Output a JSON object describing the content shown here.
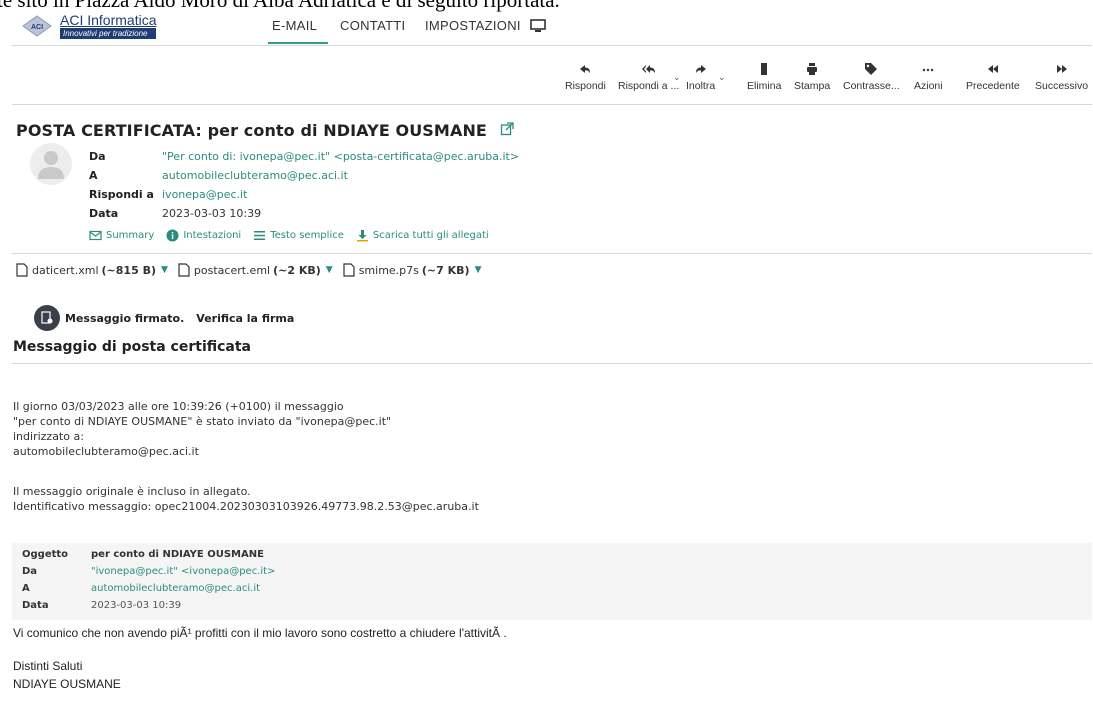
{
  "overlay_text": "te sito in Piazza Aldo Moro di Alba Adriatica e di seguito riportata.",
  "logo": {
    "title": "ACI Informatica",
    "subtitle": "Innovativi per tradizione",
    "mark": "ACI"
  },
  "nav": {
    "tabs": [
      "E-MAIL",
      "CONTATTI",
      "IMPOSTAZIONI"
    ],
    "active": "E-MAIL"
  },
  "toolbar": {
    "reply": "Rispondi",
    "reply_all": "Rispondi a ...",
    "forward": "Inoltra",
    "delete": "Elimina",
    "print": "Stampa",
    "tag": "Contrasse...",
    "actions": "Azioni",
    "previous": "Precedente",
    "next": "Successivo"
  },
  "message": {
    "subject": "POSTA CERTIFICATA: per conto di NDIAYE OUSMANE",
    "from_label": "Da",
    "from": "\"Per conto di: ivonepa@pec.it\" <posta-certificata@pec.aruba.it>",
    "to_label": "A",
    "to": "automobileclubteramo@pec.aci.it",
    "reply_to_label": "Rispondi a",
    "reply_to": "ivonepa@pec.it",
    "date_label": "Data",
    "date": "2023-03-03 10:39",
    "links": {
      "summary": "Summary",
      "headers": "Intestazioni",
      "plain": "Testo semplice",
      "download_all": "Scarica tutti gli allegati"
    }
  },
  "attachments": [
    {
      "name": "daticert.xml",
      "size": "(~815 B)"
    },
    {
      "name": "postacert.eml",
      "size": "(~2 KB)"
    },
    {
      "name": "smime.p7s",
      "size": "(~7 KB)"
    }
  ],
  "signature": {
    "label": "Messaggio firmato.",
    "verify": "Verifica la firma"
  },
  "pec": {
    "title": "Messaggio di posta certificata",
    "lines1": [
      "Il giorno 03/03/2023 alle ore 10:39:26 (+0100) il messaggio",
      "\"per conto di NDIAYE OUSMANE\" è stato inviato da \"ivonepa@pec.it\"",
      "indirizzato a:",
      "automobileclubteramo@pec.aci.it"
    ],
    "lines2": [
      "Il messaggio originale è incluso in allegato.",
      "Identificativo messaggio: opec21004.20230303103926.49773.98.2.53@pec.aruba.it"
    ]
  },
  "original": {
    "subject_label": "Oggetto",
    "subject": "per conto di NDIAYE OUSMANE",
    "from_label": "Da",
    "from": "\"ivonepa@pec.it\" <ivonepa@pec.it>",
    "to_label": "A",
    "to": "automobileclubteramo@pec.aci.it",
    "date_label": "Data",
    "date": "2023-03-03 10:39",
    "body": "Vi comunico che non avendo piÃ¹ profitti con il mio lavoro sono costretto a chiudere l'attivitÃ .",
    "greeting": "Distinti Saluti",
    "signature": "NDIAYE OUSMANE"
  },
  "colors": {
    "accent": "#2a8c7e",
    "tab_underline": "#2f9e8f",
    "brand": "#1f3c73"
  }
}
